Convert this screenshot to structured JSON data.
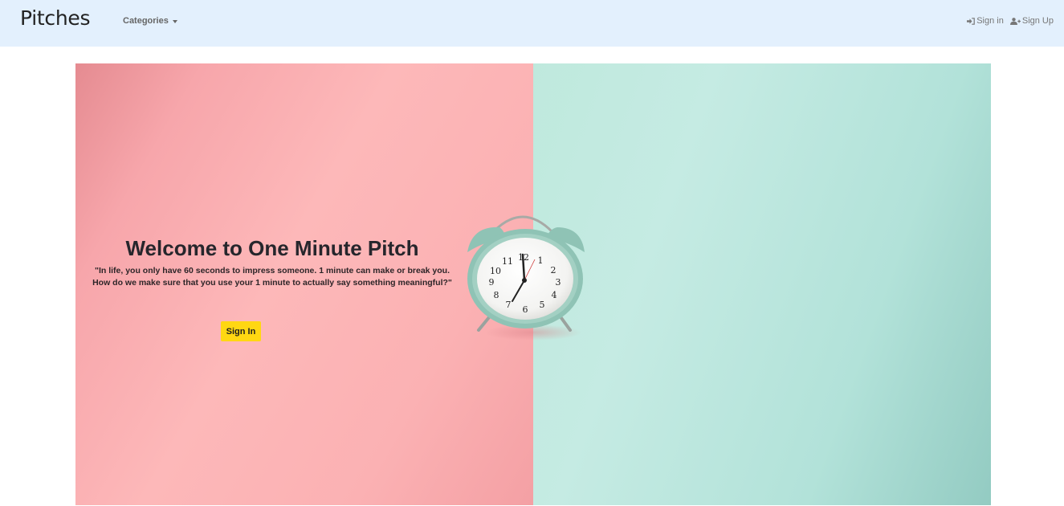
{
  "navbar": {
    "brand": "Pitches",
    "categories_label": "Categories",
    "signin_label": "Sign in",
    "signup_label": "Sign Up"
  },
  "hero": {
    "title": "Welcome to One Minute Pitch",
    "quote_line1": "\"In life, you only have 60 seconds to impress someone. 1 minute can make or break you.",
    "quote_line2": "How do we make sure that you use your 1 minute to actually say something meaningful?\"",
    "button_label": "Sign In",
    "clock_numbers": [
      "12",
      "1",
      "2",
      "3",
      "4",
      "5",
      "6",
      "7",
      "8",
      "9",
      "10",
      "11"
    ]
  },
  "colors": {
    "navbar_bg": "#e3f0fd",
    "hero_pink": "#fdb8b9",
    "hero_mint": "#c5ebe3",
    "button_yellow": "#ffd712"
  },
  "icons": {
    "signin": "sign-in-icon",
    "signup": "user-plus-icon",
    "dropdown": "caret-down-icon"
  }
}
